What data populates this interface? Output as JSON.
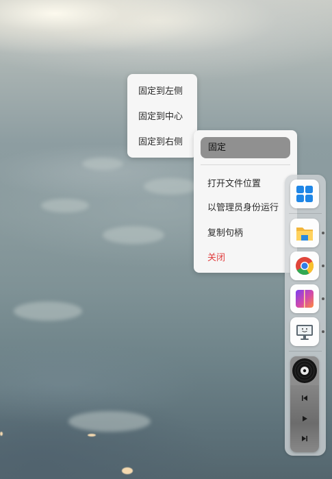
{
  "left_menu": {
    "items": [
      {
        "label": "固定到左侧"
      },
      {
        "label": "固定到中心"
      },
      {
        "label": "固定到右侧"
      }
    ]
  },
  "context_menu": {
    "pin_label": "固定",
    "items": [
      {
        "label": "打开文件位置"
      },
      {
        "label": "以管理员身份运行"
      },
      {
        "label": "复制句柄"
      },
      {
        "label": "关闭"
      }
    ]
  },
  "dock": {
    "apps": [
      {
        "icon": "windows-start-icon"
      },
      {
        "icon": "file-explorer-icon",
        "running": true
      },
      {
        "icon": "chrome-icon",
        "running": true
      },
      {
        "icon": "gradient-app-icon",
        "running": true
      },
      {
        "icon": "desktop-monitor-icon",
        "running": true
      }
    ],
    "player": {
      "art_icon": "vinyl-record-icon",
      "controls": [
        "previous-track-icon",
        "play-icon",
        "next-track-icon"
      ]
    }
  },
  "colors": {
    "menu_bg": "#f6f6f6",
    "pin_highlight": "#909090",
    "danger": "#e03c3c"
  }
}
